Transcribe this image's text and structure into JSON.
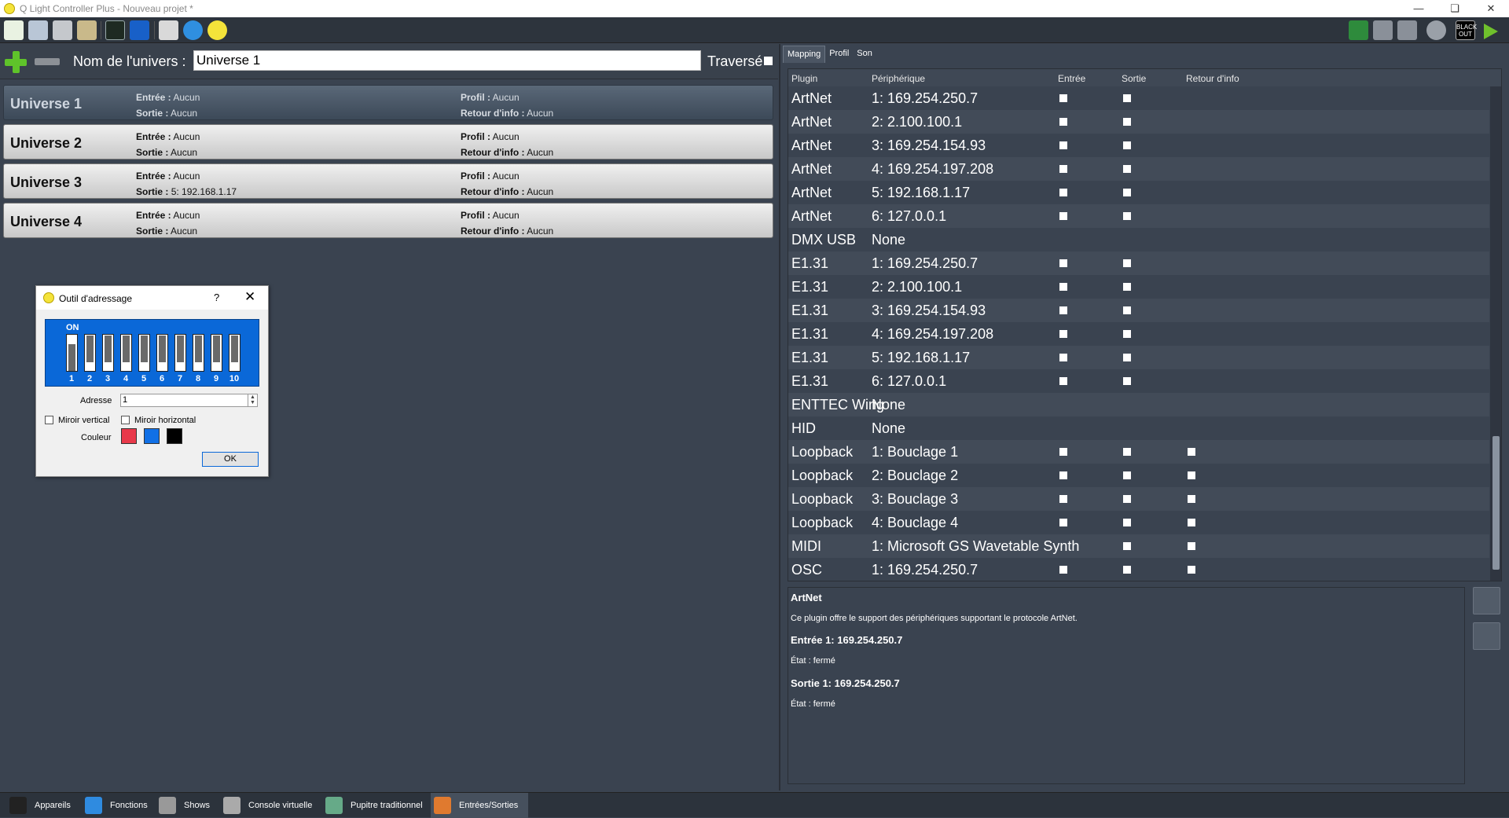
{
  "window": {
    "title": "Q Light Controller Plus - Nouveau projet *"
  },
  "toolbar": {
    "left_icons": [
      "new-project-icon",
      "open-project-icon",
      "save-project-icon",
      "save-as-icon",
      "monitor-icon",
      "address-tool-icon",
      "send-feedback-icon",
      "help-icon",
      "about-icon"
    ],
    "right_icons": [
      "live-edit-icon",
      "fade-icon",
      "panic-icon",
      "stop-all-icon"
    ],
    "blackout_label": "BLACK OUT"
  },
  "universe_panel": {
    "name_label": "Nom de l'univers :",
    "name_value": "Universe 1",
    "passthrough_label": "Traversé",
    "field_labels": {
      "input": "Entrée :",
      "output": "Sortie :",
      "profile": "Profil :",
      "feedback": "Retour d'info :"
    },
    "universes": [
      {
        "name": "Universe 1",
        "input": "Aucun",
        "output": "Aucun",
        "profile": "Aucun",
        "feedback": "Aucun",
        "selected": true
      },
      {
        "name": "Universe 2",
        "input": "Aucun",
        "output": "Aucun",
        "profile": "Aucun",
        "feedback": "Aucun"
      },
      {
        "name": "Universe 3",
        "input": "Aucun",
        "output": "5: 192.168.1.17",
        "profile": "Aucun",
        "feedback": "Aucun"
      },
      {
        "name": "Universe 4",
        "input": "Aucun",
        "output": "Aucun",
        "profile": "Aucun",
        "feedback": "Aucun"
      }
    ]
  },
  "dialog": {
    "title": "Outil d'adressage",
    "help": "?",
    "close": "✕",
    "on_label": "ON",
    "switch_numbers": [
      "1",
      "2",
      "3",
      "4",
      "5",
      "6",
      "7",
      "8",
      "9",
      "10"
    ],
    "switch_states": [
      true,
      false,
      false,
      false,
      false,
      false,
      false,
      false,
      false,
      false
    ],
    "address_label": "Adresse",
    "address_value": "1",
    "mirror_vertical": "Miroir vertical",
    "mirror_horizontal": "Miroir horizontal",
    "color_label": "Couleur",
    "colors": [
      "#e8394a",
      "#1170e6",
      "#000000"
    ],
    "ok": "OK"
  },
  "tabs": [
    "Mapping",
    "Profil",
    "Son"
  ],
  "grid": {
    "headers": [
      "Plugin",
      "Périphérique",
      "Entrée",
      "Sortie",
      "Retour d'info"
    ],
    "rows": [
      {
        "plugin": "ArtNet",
        "device": "1: 169.254.250.7",
        "in": true,
        "out": true,
        "fb": false
      },
      {
        "plugin": "ArtNet",
        "device": "2: 2.100.100.1",
        "in": true,
        "out": true,
        "fb": false
      },
      {
        "plugin": "ArtNet",
        "device": "3: 169.254.154.93",
        "in": true,
        "out": true,
        "fb": false
      },
      {
        "plugin": "ArtNet",
        "device": "4: 169.254.197.208",
        "in": true,
        "out": true,
        "fb": false
      },
      {
        "plugin": "ArtNet",
        "device": "5: 192.168.1.17",
        "in": true,
        "out": true,
        "fb": false
      },
      {
        "plugin": "ArtNet",
        "device": "6: 127.0.0.1",
        "in": true,
        "out": true,
        "fb": false
      },
      {
        "plugin": "DMX USB",
        "device": "None",
        "in": false,
        "out": false,
        "fb": false
      },
      {
        "plugin": "E1.31",
        "device": "1: 169.254.250.7",
        "in": true,
        "out": true,
        "fb": false
      },
      {
        "plugin": "E1.31",
        "device": "2: 2.100.100.1",
        "in": true,
        "out": true,
        "fb": false
      },
      {
        "plugin": "E1.31",
        "device": "3: 169.254.154.93",
        "in": true,
        "out": true,
        "fb": false
      },
      {
        "plugin": "E1.31",
        "device": "4: 169.254.197.208",
        "in": true,
        "out": true,
        "fb": false
      },
      {
        "plugin": "E1.31",
        "device": "5: 192.168.1.17",
        "in": true,
        "out": true,
        "fb": false
      },
      {
        "plugin": "E1.31",
        "device": "6: 127.0.0.1",
        "in": true,
        "out": true,
        "fb": false
      },
      {
        "plugin": "ENTTEC Wing",
        "device": "None",
        "in": false,
        "out": false,
        "fb": false
      },
      {
        "plugin": "HID",
        "device": "None",
        "in": false,
        "out": false,
        "fb": false
      },
      {
        "plugin": "Loopback",
        "device": "1: Bouclage 1",
        "in": true,
        "out": true,
        "fb": true
      },
      {
        "plugin": "Loopback",
        "device": "2: Bouclage 2",
        "in": true,
        "out": true,
        "fb": true
      },
      {
        "plugin": "Loopback",
        "device": "3: Bouclage 3",
        "in": true,
        "out": true,
        "fb": true
      },
      {
        "plugin": "Loopback",
        "device": "4: Bouclage 4",
        "in": true,
        "out": true,
        "fb": true
      },
      {
        "plugin": "MIDI",
        "device": "1: Microsoft GS Wavetable Synth",
        "in": false,
        "out": true,
        "fb": true
      },
      {
        "plugin": "OSC",
        "device": "1: 169.254.250.7",
        "in": true,
        "out": true,
        "fb": true
      }
    ]
  },
  "info": {
    "plugin": "ArtNet",
    "description": "Ce plugin offre le support des périphériques supportant le protocole ArtNet.",
    "input_title": "Entrée 1: 169.254.250.7",
    "input_state": "État : fermé",
    "output_title": "Sortie 1: 169.254.250.7",
    "output_state": "État : fermé"
  },
  "bottom_tabs": [
    {
      "label": "Appareils",
      "icon": "fixtures-icon",
      "color": "#222"
    },
    {
      "label": "Fonctions",
      "icon": "functions-icon",
      "color": "#2f8be0"
    },
    {
      "label": "Shows",
      "icon": "shows-icon",
      "color": "#999"
    },
    {
      "label": "Console virtuelle",
      "icon": "virtual-console-icon",
      "color": "#aaa"
    },
    {
      "label": "Pupitre traditionnel",
      "icon": "simple-desk-icon",
      "color": "#6a8"
    },
    {
      "label": "Entrées/Sorties",
      "icon": "inputs-outputs-icon",
      "color": "#e07a2f",
      "active": true
    }
  ]
}
